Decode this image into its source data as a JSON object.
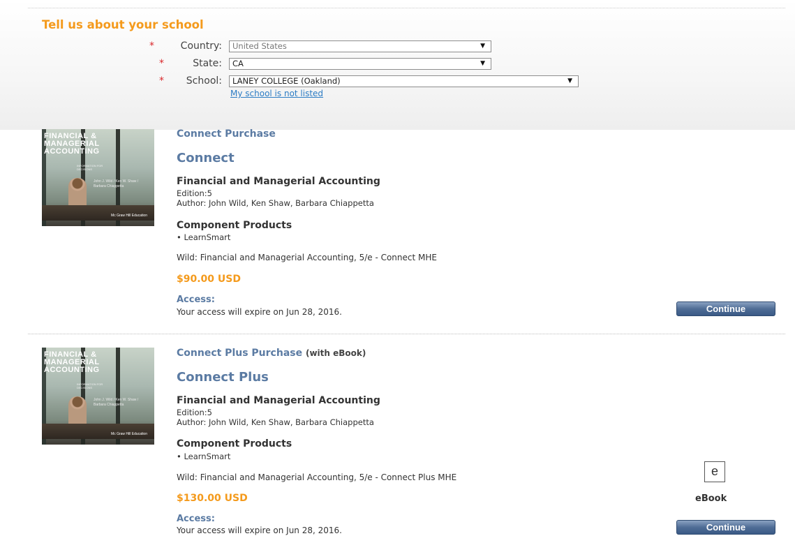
{
  "school_form": {
    "heading": "Tell us about your school",
    "required_marker": "*",
    "country": {
      "label": "Country:",
      "value": "United States"
    },
    "state": {
      "label": "State:",
      "value": "CA"
    },
    "school": {
      "label": "School:",
      "value": "LANEY COLLEGE (Oakland)"
    },
    "not_listed_link": "My school is not listed",
    "dropdown_arrow": "▼"
  },
  "products": [
    {
      "cover": {
        "title": "FINANCIAL & MANAGERIAL ACCOUNTING",
        "subtitle": "INFORMATION FOR DECISIONS",
        "authors": "John J. Wild / Ken W. Shaw / Barbara Chiappetta",
        "publisher": "Mc Graw Hill Education"
      },
      "purchase_type": "Connect Purchase",
      "purchase_note": "",
      "product_name": "Connect",
      "book_title": "Financial and Managerial Accounting",
      "edition": "Edition:5",
      "author": "Author: John Wild, Ken Shaw, Barbara Chiappetta",
      "component_title": "Component Products",
      "component_items": [
        "• LearnSmart"
      ],
      "description": "Wild: Financial and Managerial Accounting, 5/e - Connect MHE",
      "price": "$90.00 USD",
      "access_label": "Access:",
      "access_text": "Your access will expire on Jun 28, 2016.",
      "continue_label": "Continue"
    },
    {
      "cover": {
        "title": "FINANCIAL & MANAGERIAL ACCOUNTING",
        "subtitle": "INFORMATION FOR DECISIONS",
        "authors": "John J. Wild / Ken W. Shaw / Barbara Chiappetta",
        "publisher": "Mc Graw Hill Education"
      },
      "purchase_type": "Connect Plus Purchase",
      "purchase_note": "(with eBook)",
      "product_name": "Connect Plus",
      "book_title": "Financial and Managerial Accounting",
      "edition": "Edition:5",
      "author": "Author: John Wild, Ken Shaw, Barbara Chiappetta",
      "component_title": "Component Products",
      "component_items": [
        "• LearnSmart"
      ],
      "description": "Wild: Financial and Managerial Accounting, 5/e - Connect Plus MHE",
      "price": "$130.00 USD",
      "access_label": "Access:",
      "access_text": "Your access will expire on Jun 28, 2016.",
      "continue_label": "Continue",
      "ebook": {
        "icon_letter": "e",
        "label": "eBook"
      }
    }
  ]
}
